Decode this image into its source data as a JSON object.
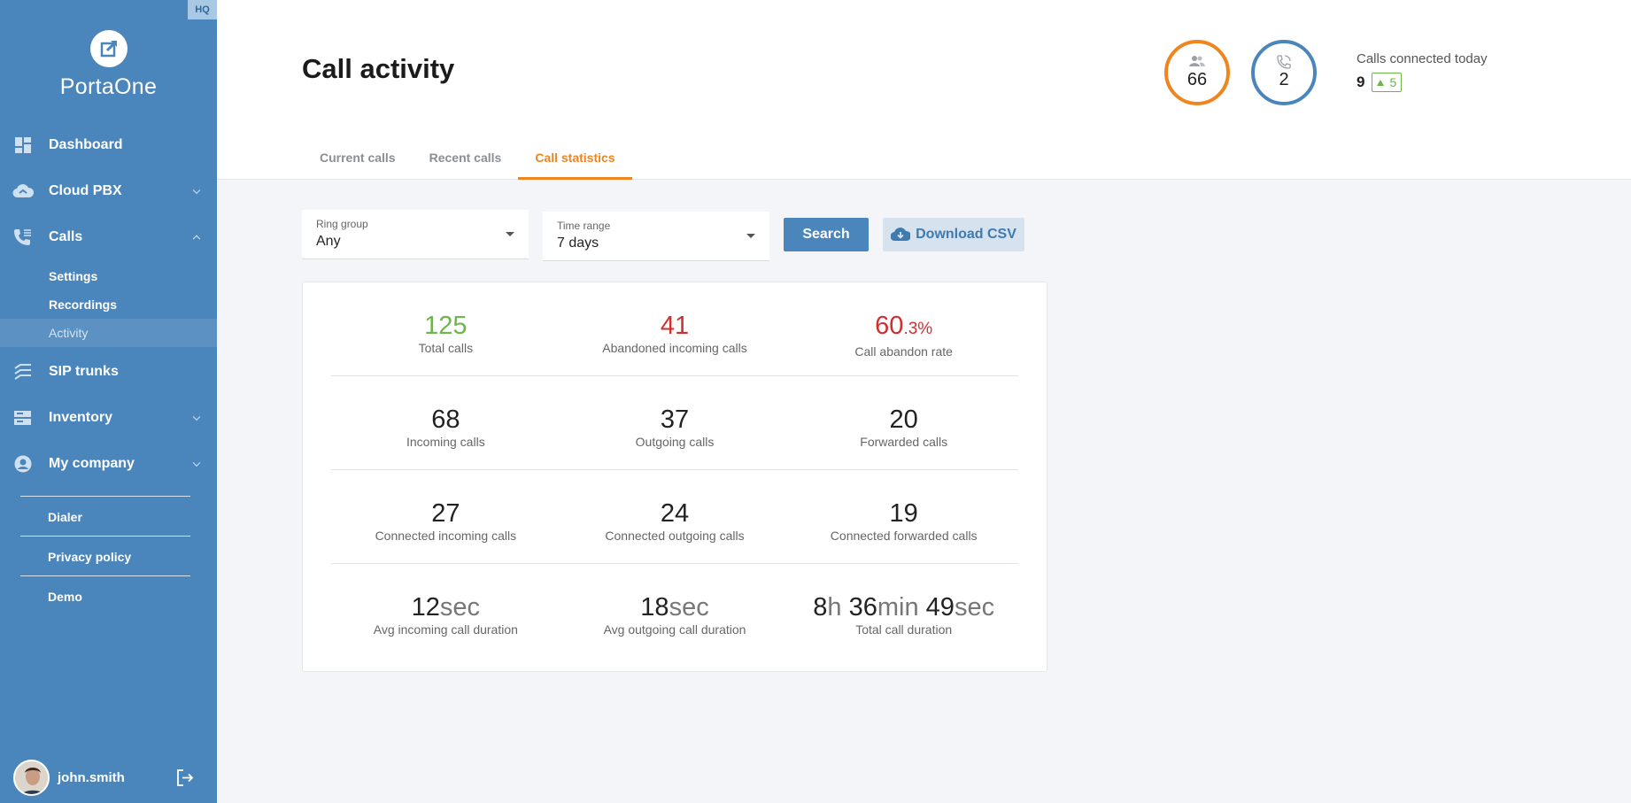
{
  "sidebar": {
    "badge": "HQ",
    "brand": "PortaOne",
    "items": [
      {
        "label": "Dashboard"
      },
      {
        "label": "Cloud PBX"
      },
      {
        "label": "Calls"
      },
      {
        "label": "SIP trunks"
      },
      {
        "label": "Inventory"
      },
      {
        "label": "My company"
      }
    ],
    "calls_sub": [
      {
        "label": "Settings"
      },
      {
        "label": "Recordings"
      },
      {
        "label": "Activity"
      }
    ],
    "extra": [
      {
        "label": "Dialer"
      },
      {
        "label": "Privacy policy"
      },
      {
        "label": "Demo"
      }
    ],
    "user": "john.smith"
  },
  "header": {
    "title": "Call activity",
    "tabs": [
      {
        "label": "Current calls"
      },
      {
        "label": "Recent calls"
      },
      {
        "label": "Call statistics"
      }
    ],
    "rings": [
      {
        "icon": "users-icon",
        "value": "66"
      },
      {
        "icon": "phone-icon",
        "value": "2"
      }
    ],
    "connected_label": "Calls connected today",
    "connected_value": "9",
    "connected_delta": "5"
  },
  "filters": {
    "ring_group_label": "Ring group",
    "ring_group_value": "Any",
    "time_range_label": "Time range",
    "time_range_value": "7 days",
    "search_label": "Search",
    "csv_label": "Download CSV"
  },
  "stats": {
    "total_calls": {
      "value": "125",
      "label": "Total calls"
    },
    "abandoned": {
      "value": "41",
      "label": "Abandoned incoming calls"
    },
    "abandon_rate": {
      "value": "60",
      "decimal": ".3%",
      "label": "Call abandon rate"
    },
    "incoming": {
      "value": "68",
      "label": "Incoming calls"
    },
    "outgoing": {
      "value": "37",
      "label": "Outgoing calls"
    },
    "forwarded": {
      "value": "20",
      "label": "Forwarded calls"
    },
    "conn_incoming": {
      "value": "27",
      "label": "Connected incoming calls"
    },
    "conn_outgoing": {
      "value": "24",
      "label": "Connected outgoing calls"
    },
    "conn_forwarded": {
      "value": "19",
      "label": "Connected forwarded calls"
    },
    "avg_in": {
      "value": "12",
      "unit": "sec",
      "label": "Avg incoming call duration"
    },
    "avg_out": {
      "value": "18",
      "unit": "sec",
      "label": "Avg outgoing call duration"
    },
    "total_dur": {
      "h": "8",
      "h_unit": "h",
      "m": "36",
      "m_unit": "min",
      "s": "49",
      "s_unit": "sec",
      "label": "Total call duration"
    }
  }
}
